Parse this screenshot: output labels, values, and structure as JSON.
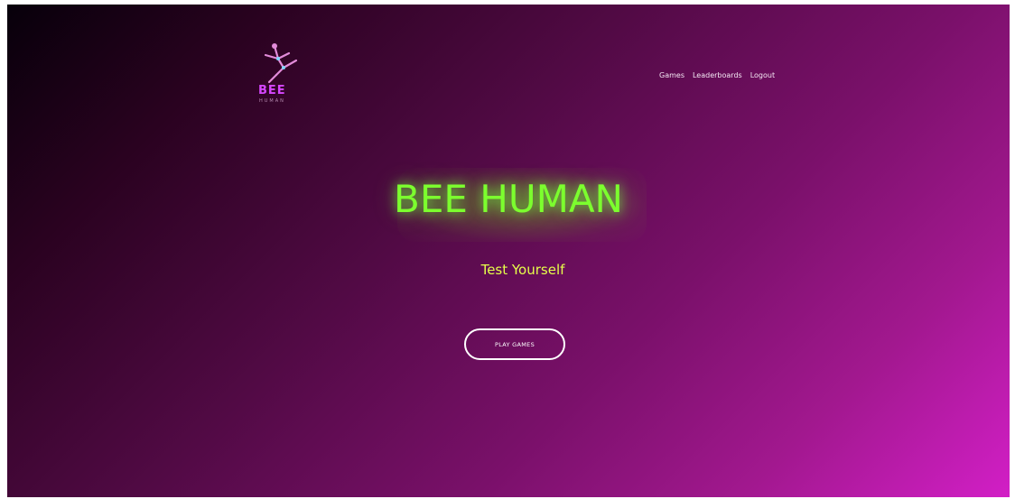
{
  "logo": {
    "icon": "dancing-figure-icon",
    "word": "BEE",
    "sub": "HUMAN"
  },
  "nav": {
    "items": [
      "Games",
      "Leaderboards",
      "Logout"
    ]
  },
  "hero": {
    "title": "BEE HUMAN",
    "subtitle": "Test Yourself",
    "button_label": "PLAY GAMES"
  },
  "colors": {
    "title": "#7cff2e",
    "subtitle": "#e6ff4a",
    "logo_accent": "#d646ff",
    "background_start": "#07000a",
    "background_end": "#d21fc6"
  }
}
